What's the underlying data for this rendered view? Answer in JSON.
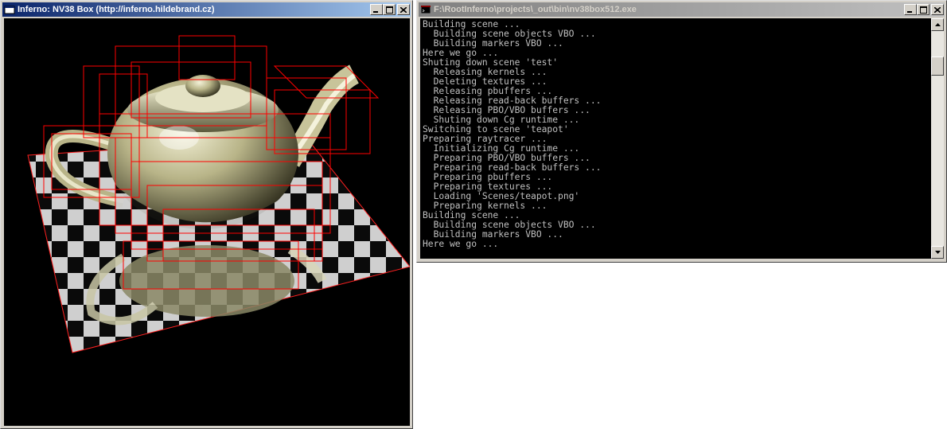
{
  "render_window": {
    "title": "Inferno: NV38 Box (http://inferno.hildebrand.cz)",
    "icon": "app-icon"
  },
  "console_window": {
    "title": "F:\\RootInferno\\projects\\_out\\bin\\nv38box512.exe",
    "icon": "console-icon",
    "lines": [
      "Building scene ...",
      "  Building scene objects VBO ...",
      "  Building markers VBO ...",
      "Here we go ...",
      "Shuting down scene 'test'",
      "  Releasing kernels ...",
      "  Deleting textures ...",
      "  Releasing pbuffers ...",
      "  Releasing read-back buffers ...",
      "  Releasing PBO/VBO buffers ...",
      "  Shuting down Cg runtime ...",
      "Switching to scene 'teapot'",
      "Preparing raytracer ...",
      "  Initializing Cg runtime ...",
      "  Preparing PBO/VBO buffers ...",
      "  Preparing read-back buffers ...",
      "  Preparing pbuffers ...",
      "  Preparing textures ...",
      "  Loading 'Scenes/teapot.png'",
      "  Preparing kernels ...",
      "Building scene ...",
      "  Building scene objects VBO ...",
      "  Building markers VBO ...",
      "Here we go ..."
    ]
  },
  "icons": [
    "minimize-icon",
    "maximize-icon",
    "close-icon",
    "scroll-up-icon",
    "scroll-down-icon"
  ],
  "colors": {
    "title_active": "#0a246a",
    "title_inactive": "#808080",
    "bbox_red": "#ff0000",
    "teapot": "#d8d4a8"
  }
}
